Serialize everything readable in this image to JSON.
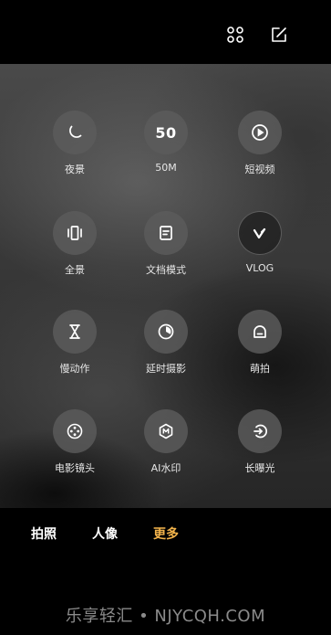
{
  "topbar": {
    "icons": [
      "grid-icon",
      "edit-icon"
    ]
  },
  "modes": [
    {
      "id": "night",
      "label": "夜景",
      "icon": "moon-icon"
    },
    {
      "id": "50m",
      "label": "50M",
      "icon_text": "50"
    },
    {
      "id": "short-video",
      "label": "短视频",
      "icon": "play-circle-icon"
    },
    {
      "id": "panorama",
      "label": "全景",
      "icon": "panorama-icon"
    },
    {
      "id": "document",
      "label": "文档模式",
      "icon": "document-icon"
    },
    {
      "id": "vlog",
      "label": "VLOG",
      "icon": "vlog-icon"
    },
    {
      "id": "slow-motion",
      "label": "慢动作",
      "icon": "hourglass-icon"
    },
    {
      "id": "timelapse",
      "label": "延时摄影",
      "icon": "timelapse-icon"
    },
    {
      "id": "cute",
      "label": "萌拍",
      "icon": "cute-face-icon"
    },
    {
      "id": "movie-lens",
      "label": "电影镜头",
      "icon": "film-reel-icon"
    },
    {
      "id": "ai-watermark",
      "label": "AI水印",
      "icon": "hexagon-m-icon"
    },
    {
      "id": "long-exposure",
      "label": "长曝光",
      "icon": "long-exposure-icon"
    }
  ],
  "tabs": [
    {
      "label": "拍照",
      "active": false
    },
    {
      "label": "人像",
      "active": false
    },
    {
      "label": "更多",
      "active": true
    }
  ],
  "colors": {
    "active_tab": "#f2b34b"
  },
  "watermark": "乐享轻汇 • NJYCQH.COM"
}
